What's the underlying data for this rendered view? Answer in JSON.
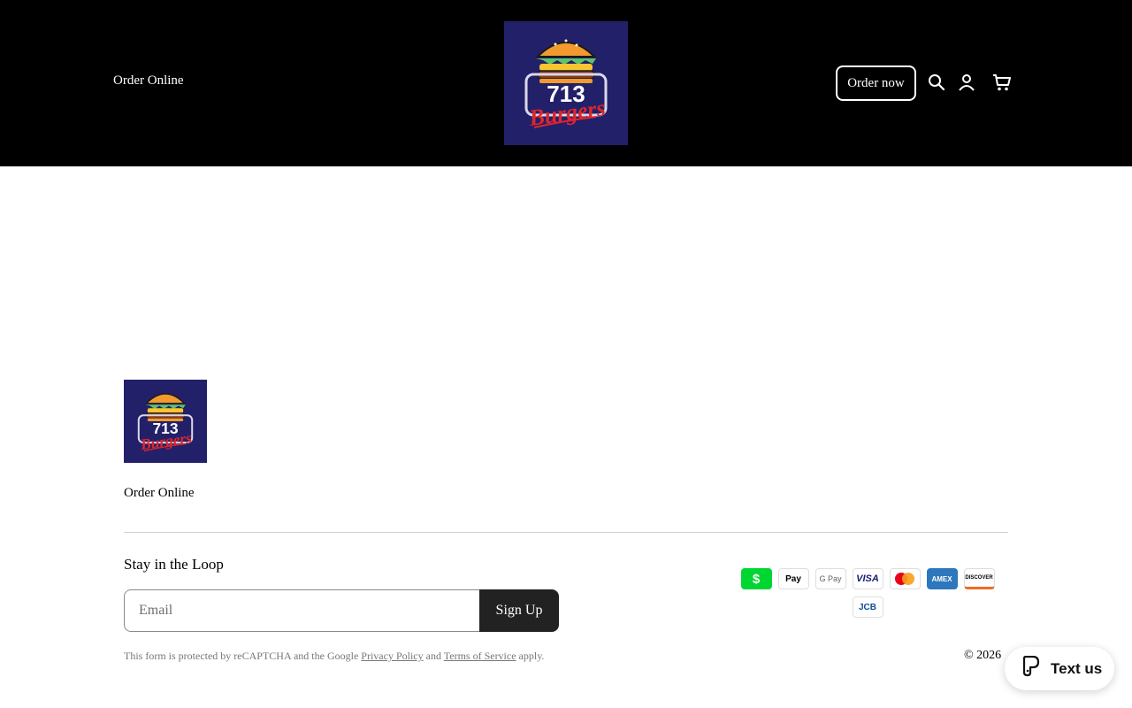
{
  "header": {
    "nav_link": "Order Online",
    "order_button": "Order now",
    "logo": {
      "number": "713",
      "word": "Burgers"
    }
  },
  "footer": {
    "logo": {
      "number": "713",
      "word": "Burgers"
    },
    "nav_link": "Order Online",
    "newsletter": {
      "title": "Stay in the Loop",
      "email_placeholder": "Email",
      "email_value": "",
      "button": "Sign Up"
    },
    "recaptcha": {
      "prefix": "This form is protected by reCAPTCHA and the Google",
      "privacy_link": "Privacy Policy",
      "and": "and",
      "terms_link": "Terms of Service",
      "suffix": "apply."
    },
    "payments": {
      "row1": [
        {
          "name": "cash-app",
          "text": "$"
        },
        {
          "name": "apple-pay",
          "text": "Pay"
        },
        {
          "name": "google-pay",
          "text": "G Pay"
        },
        {
          "name": "visa",
          "text": "VISA"
        },
        {
          "name": "mastercard",
          "text": ""
        },
        {
          "name": "amex",
          "text": "AMEX"
        },
        {
          "name": "discover",
          "text": "DISCOVER"
        }
      ],
      "row2": [
        {
          "name": "jcb",
          "text": "JCB"
        }
      ]
    },
    "copyright": "© 2026"
  },
  "chat_widget": {
    "label": "Text us"
  },
  "colors": {
    "header_bg": "#000000",
    "logo_bg": "#23206a",
    "button_dark": "#222222",
    "burger_red": "#e0252b",
    "bun_orange": "#f29a2e"
  }
}
